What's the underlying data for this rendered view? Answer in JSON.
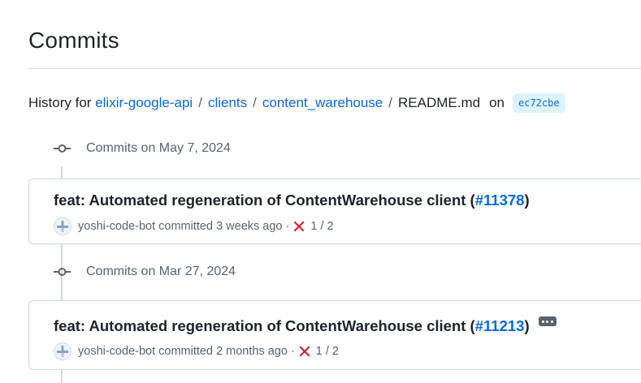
{
  "page": {
    "title": "Commits"
  },
  "breadcrumb": {
    "prefix": "History for",
    "parts": [
      "elixir-google-api",
      "clients",
      "content_warehouse"
    ],
    "separator": "/",
    "current_file": "README.md",
    "on_label": "on",
    "sha": "ec72cbe"
  },
  "groups": [
    {
      "header": "Commits on May 7, 2024",
      "commits": [
        {
          "title_text": "feat: Automated regeneration of ContentWarehouse client (",
          "pr_link": "#11378",
          "title_suffix": ")",
          "author": "yoshi-code-bot",
          "action": "committed",
          "time": "3 weeks ago",
          "separator": "·",
          "checks": "1 / 2",
          "has_ellipsis": false
        }
      ]
    },
    {
      "header": "Commits on Mar 27, 2024",
      "commits": [
        {
          "title_text": "feat: Automated regeneration of ContentWarehouse client (",
          "pr_link": "#11213",
          "title_suffix": ")",
          "author": "yoshi-code-bot",
          "action": "committed",
          "time": "2 months ago",
          "separator": "·",
          "checks": "1 / 2",
          "has_ellipsis": true
        }
      ]
    }
  ],
  "colors": {
    "link": "#0969da",
    "text": "#1f2328",
    "muted": "#59636e",
    "border": "#d1d9e0",
    "fail": "#cf222e",
    "sha_bg": "#ddf4ff"
  },
  "icons": {
    "commit": "git-commit-icon",
    "fail": "x-icon",
    "avatar": "bot-avatar-icon",
    "ellipsis": "ellipsis-icon"
  }
}
